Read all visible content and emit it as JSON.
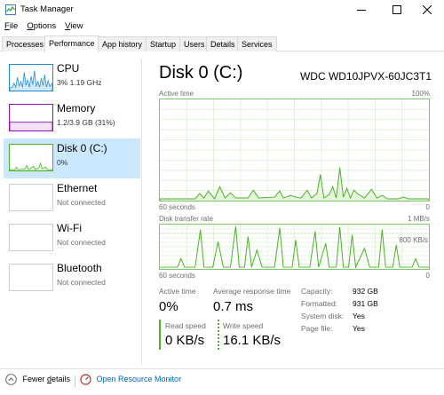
{
  "window": {
    "title": "Task Manager"
  },
  "menu": [
    {
      "label_u": "F",
      "label_rest": "ile"
    },
    {
      "label_u": "O",
      "label_rest": "ptions"
    },
    {
      "label_u": "V",
      "label_rest": "iew"
    }
  ],
  "tabs": [
    "Processes",
    "Performance",
    "App history",
    "Startup",
    "Users",
    "Details",
    "Services"
  ],
  "sidebar": {
    "cpu": {
      "name": "CPU",
      "sub": "3%  1.19 GHz"
    },
    "memory": {
      "name": "Memory",
      "sub": "1.2/3.9 GB (31%)"
    },
    "disk": {
      "name": "Disk 0 (C:)",
      "sub": "0%"
    },
    "ethernet": {
      "name": "Ethernet",
      "sub": "Not connected"
    },
    "wifi": {
      "name": "Wi-Fi",
      "sub": "Not connected"
    },
    "bluetooth": {
      "name": "Bluetooth",
      "sub": "Not connected"
    }
  },
  "detail": {
    "title": "Disk 0 (C:)",
    "model": "WDC WD10JPVX-60JC3T1",
    "graph1": {
      "label": "Active time",
      "max": "100%",
      "time_left": "60 seconds",
      "time_right": "0"
    },
    "graph2": {
      "label": "Disk transfer rate",
      "max": "1 MB/s",
      "mid": "800 KB/s",
      "time_left": "60 seconds",
      "time_right": "0"
    },
    "stats": {
      "active_time_label": "Active time",
      "active_time_value": "0%",
      "avg_resp_label": "Average response time",
      "avg_resp_value": "0.7 ms",
      "read_label": "Read speed",
      "read_value": "0 KB/s",
      "write_label": "Write speed",
      "write_value": "16.1 KB/s"
    },
    "info": {
      "capacity_label": "Capacity:",
      "capacity_value": "932 GB",
      "formatted_label": "Formatted:",
      "formatted_value": "931 GB",
      "system_label": "System disk:",
      "system_value": "Yes",
      "pagefile_label": "Page file:",
      "pagefile_value": "Yes"
    }
  },
  "footer": {
    "fewer_details": "Fewer details",
    "fewer_details_u": "d",
    "open_monitor": "Open Resource Monitor"
  },
  "colors": {
    "disk_green": "#4caf29",
    "cpu_blue": "#1e8bd6",
    "memory_purple": "#8b12ae",
    "selected_bg": "#cce8ff"
  }
}
